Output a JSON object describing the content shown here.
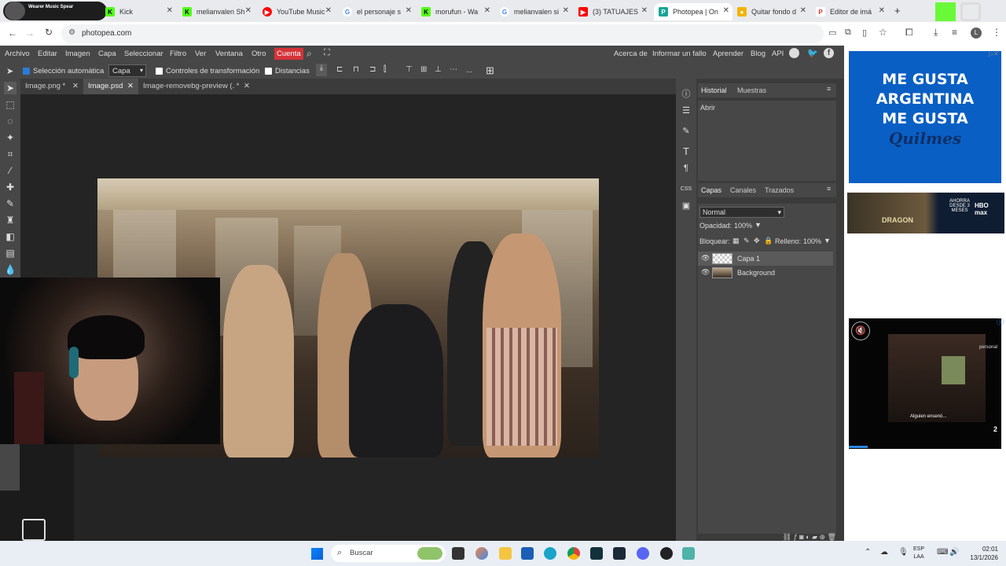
{
  "browser": {
    "tabs": [
      {
        "label": "Kick"
      },
      {
        "label": "melianvalen Sh"
      },
      {
        "label": "YouTube Music"
      },
      {
        "label": "el personaje s"
      },
      {
        "label": "morufun - Wa"
      },
      {
        "label": "melianvalen si"
      },
      {
        "label": "(3) TATUAJES"
      },
      {
        "label": "Photopea | On"
      },
      {
        "label": "Quitar fondo d"
      },
      {
        "label": "Editor de imá"
      }
    ],
    "profile_label": "Wearer Music Spear",
    "url": "photopea.com",
    "new_tab": "+"
  },
  "photopea": {
    "menu": [
      "Archivo",
      "Editar",
      "Imagen",
      "Capa",
      "Seleccionar",
      "Filtro",
      "Ver",
      "Ventana",
      "Otro"
    ],
    "account": "Cuenta",
    "right_links": [
      "Acerca de",
      "Informar un fallo",
      "Aprender",
      "Blog",
      "API"
    ],
    "options": {
      "auto_select": "Selección automática",
      "layer_select": "Capa",
      "transform_controls": "Controles de transformación",
      "distances": "Distancias",
      "more": "..."
    },
    "doc_tabs": [
      "Image.png *",
      "Image.psd",
      "Image-removebg-preview (. *"
    ],
    "history": {
      "tabs": [
        "Historial",
        "Muestras"
      ],
      "items": [
        "Abrir"
      ]
    },
    "layers": {
      "tabs": [
        "Capas",
        "Canales",
        "Trazados"
      ],
      "blend": "Normal",
      "opacity_label": "Opacidad:",
      "opacity_value": "100%",
      "lock_label": "Bloquear:",
      "fill_label": "Relleno:",
      "fill_value": "100%",
      "items": [
        "Capa 1",
        "Background"
      ]
    },
    "side_icons_text": {
      "css": "CSS"
    }
  },
  "ads": {
    "ad1_lines": [
      "ME GUSTA",
      "ARGENTINA",
      "ME GUSTA"
    ],
    "ad1_brand": "Quilmes",
    "ad2_left": "DRAGON",
    "ad2_right": "HBO max",
    "ad2_promo": "AHORRA DESDE 3 MESES",
    "ad3_caption": "Alguien ensenó...",
    "ad3_count": "2",
    "ad3_tag": "personal"
  },
  "taskbar": {
    "search": "Buscar",
    "lang": "ESP",
    "lang2": "LAA",
    "time": "02:01",
    "date": "13/1/2026"
  }
}
